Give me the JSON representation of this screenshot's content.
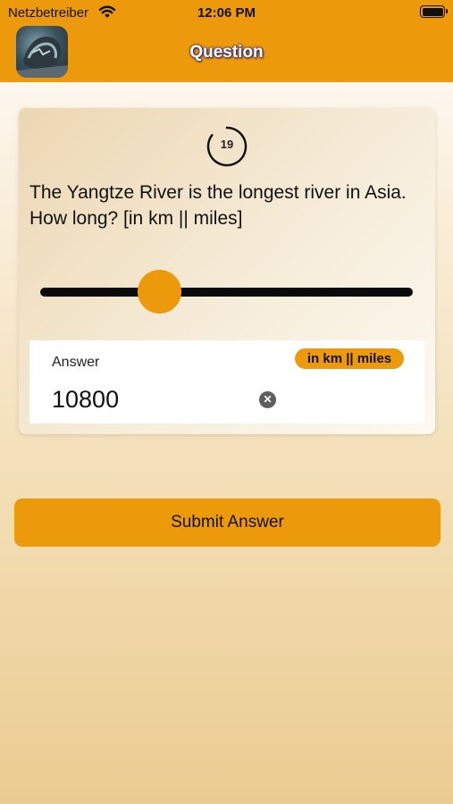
{
  "status_bar": {
    "carrier": "Netzbetreiber",
    "time": "12:06 PM"
  },
  "nav": {
    "title": "Question",
    "app_icon": "app-logo-icon"
  },
  "question": {
    "timer": "19",
    "text": "The Yangtze River is the longest river in Asia. How long? [in km || miles]"
  },
  "slider": {
    "value_fraction": 0.32
  },
  "answer": {
    "label": "Answer",
    "unit_badge": "in km || miles",
    "value": "10800",
    "clear_icon": "clear-icon"
  },
  "submit": {
    "label": "Submit Answer"
  },
  "colors": {
    "accent": "#ec9a0c",
    "track": "#0a0a0a"
  }
}
